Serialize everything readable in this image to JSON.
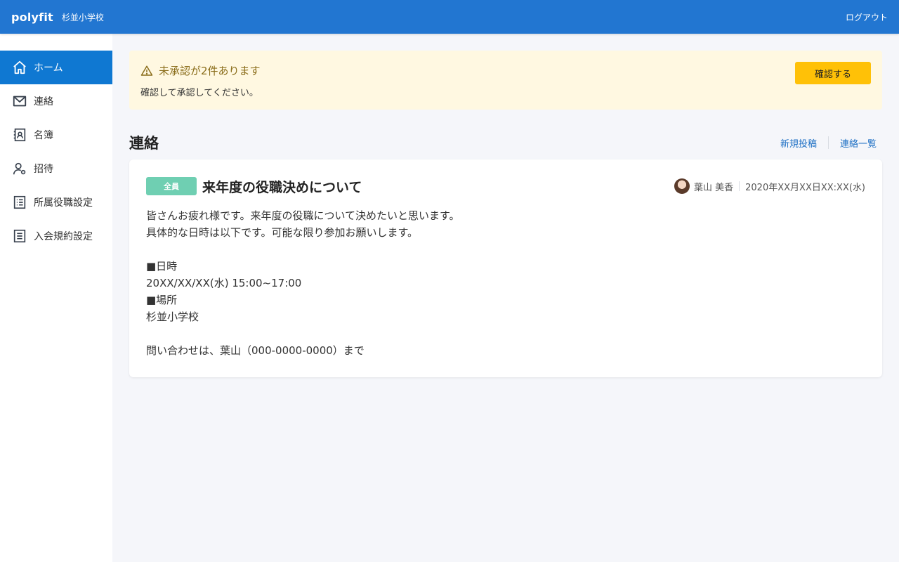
{
  "header": {
    "brand": "polyfit",
    "school": "杉並小学校",
    "logout": "ログアウト"
  },
  "sidebar": {
    "items": [
      {
        "label": "ホーム",
        "icon": "home-icon",
        "active": true
      },
      {
        "label": "連絡",
        "icon": "mail-icon"
      },
      {
        "label": "名簿",
        "icon": "address-book-icon"
      },
      {
        "label": "招待",
        "icon": "invite-user-icon"
      },
      {
        "label": "所属役職設定",
        "icon": "list-icon"
      },
      {
        "label": "入会規約設定",
        "icon": "document-icon"
      }
    ]
  },
  "alert": {
    "title": "未承認が2件あります",
    "description": "確認して承認してください。",
    "button": "確認する"
  },
  "section": {
    "title": "連絡",
    "new_post": "新規投稿",
    "list": "連絡一覧"
  },
  "post": {
    "badge": "全員",
    "title": "来年度の役職決めについて",
    "author": "葉山 美香",
    "date": "2020年XX月XX日XX:XX(水)",
    "lines": [
      "皆さんお疲れ様です。来年度の役職について決めたいと思います。",
      "具体的な日時は以下です。可能な限り参加お願いします。",
      "",
      "■日時",
      "20XX/XX/XX(水) 15:00~17:00",
      "■場所",
      "杉並小学校",
      "",
      "問い合わせは、葉山（000-0000-0000）まで"
    ]
  },
  "colors": {
    "header": "#2276d1",
    "active_nav": "#0f78d2",
    "alert_bg": "#fff8e1",
    "alert_button": "#ffc107",
    "badge": "#6fcfb2",
    "link": "#1d6fc4"
  }
}
